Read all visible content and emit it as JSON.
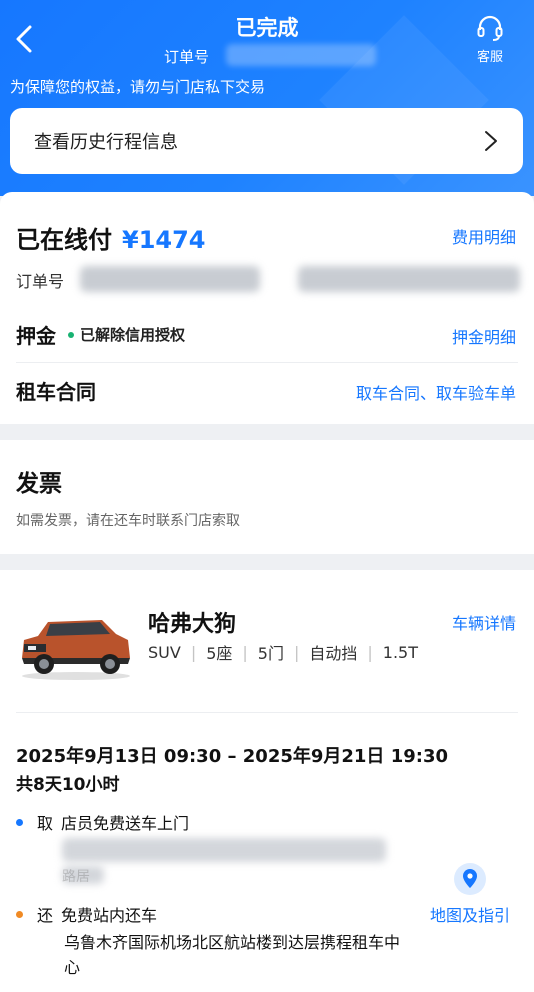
{
  "header": {
    "title": "已完成",
    "order_label": "订单号",
    "customer_service": "客服",
    "notice": "为保障您的权益，请勿与门店私下交易",
    "history_link": "查看历史行程信息"
  },
  "payment": {
    "label": "已在线付",
    "amount": "¥1474",
    "fee_detail": "费用明细",
    "order_label": "订单号"
  },
  "deposit": {
    "label": "押金",
    "status": "已解除信用授权",
    "detail": "押金明细"
  },
  "contract": {
    "label": "租车合同",
    "link": "取车合同、取车验车单"
  },
  "invoice": {
    "title": "发票",
    "desc": "如需发票，请在还车时联系门店索取"
  },
  "vehicle": {
    "name": "哈弗大狗",
    "detail_link": "车辆详情",
    "specs": [
      "SUV",
      "5座",
      "5门",
      "自动挡",
      "1.5T"
    ]
  },
  "rental": {
    "time_range": "2025年9月13日 09:30 – 2025年9月21日 19:30",
    "duration": "共8天10小时",
    "pickup_label": "取",
    "pickup_text": "店员免费送车上门",
    "pickup_addr_tail": "路居",
    "return_label": "还",
    "return_text": "免费站内还车",
    "return_address": "乌鲁木齐国际机场北区航站楼到达层携程租车中心",
    "map_link": "地图及指引"
  },
  "colors": {
    "primary": "#1677ff",
    "pickup_dot": "#1677ff",
    "return_dot": "#f08a24",
    "status_dot": "#18b272"
  }
}
